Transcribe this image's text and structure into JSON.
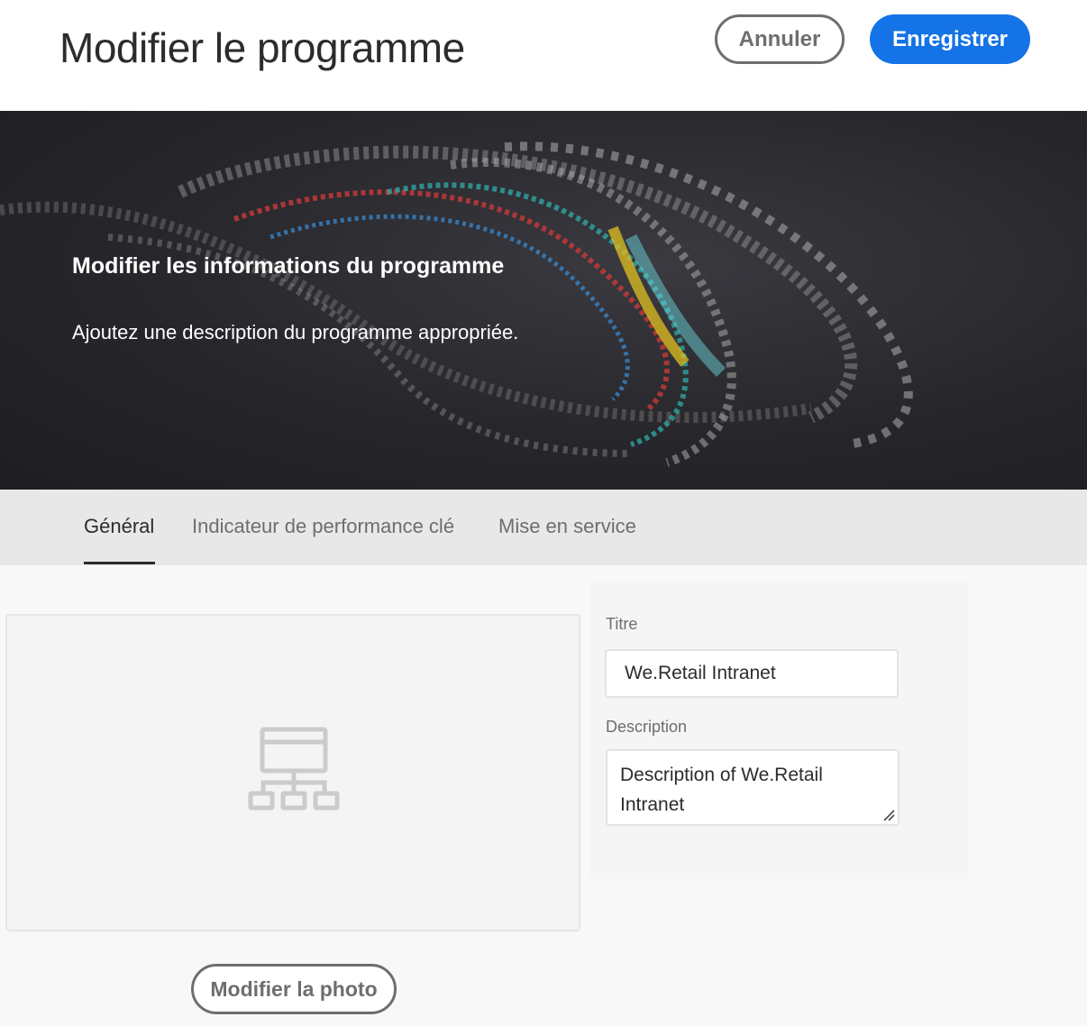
{
  "header": {
    "title": "Modifier le programme",
    "cancel_label": "Annuler",
    "save_label": "Enregistrer"
  },
  "hero": {
    "title": "Modifier les informations du programme",
    "description": "Ajoutez une description du programme appropriée."
  },
  "tabs": [
    {
      "label": "Général",
      "active": true
    },
    {
      "label": "Indicateur de performance clé",
      "active": false
    },
    {
      "label": "Mise en service",
      "active": false
    }
  ],
  "form": {
    "title_label": "Titre",
    "title_value": "We.Retail Intranet",
    "description_label": "Description",
    "description_value": "Description of We.Retail Intranet"
  },
  "image": {
    "placeholder_icon": "site-structure-icon",
    "change_photo_label": "Modifier la photo"
  },
  "colors": {
    "primary": "#1473e6",
    "hero_bg": "#26262b",
    "tab_bar": "#e8e8e8"
  }
}
